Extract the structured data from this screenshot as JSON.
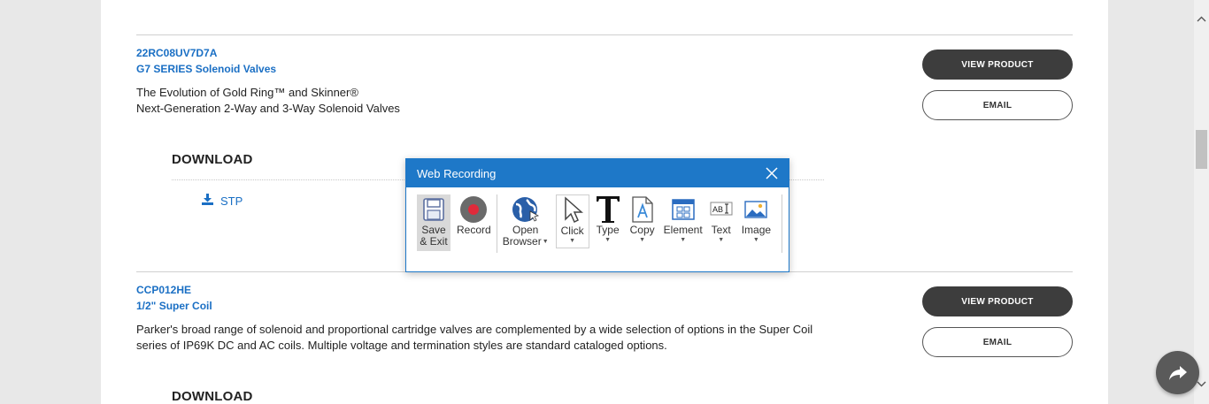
{
  "products": [
    {
      "part_number": "22RC08UV7D7A",
      "name": "G7 SERIES Solenoid Valves",
      "description_lines": [
        "The Evolution of Gold Ring™ and Skinner®",
        "Next-Generation 2-Way and 3-Way Solenoid Valves"
      ],
      "download_heading": "DOWNLOAD",
      "download_link": "STP",
      "view_button": "VIEW PRODUCT",
      "email_button": "EMAIL"
    },
    {
      "part_number": "CCP012HE",
      "name": "1/2\" Super Coil",
      "description_lines": [
        "Parker's broad range of solenoid and proportional cartridge valves are complemented by a wide selection of options in the Super Coil",
        "series of IP69K DC and AC coils. Multiple voltage and termination styles are standard cataloged options."
      ],
      "download_heading": "DOWNLOAD",
      "view_button": "VIEW PRODUCT",
      "email_button": "EMAIL"
    }
  ],
  "dialog": {
    "title": "Web Recording",
    "tools": {
      "save_exit": [
        "Save",
        "& Exit"
      ],
      "record": "Record",
      "open_browser": [
        "Open",
        "Browser"
      ],
      "click": "Click",
      "type": "Type",
      "copy": "Copy",
      "element": "Element",
      "text": "Text",
      "image": "Image"
    }
  },
  "colors": {
    "link": "#1a6fc4",
    "dialog_accent": "#1e78c8",
    "dark_button": "#3d3d3d"
  }
}
